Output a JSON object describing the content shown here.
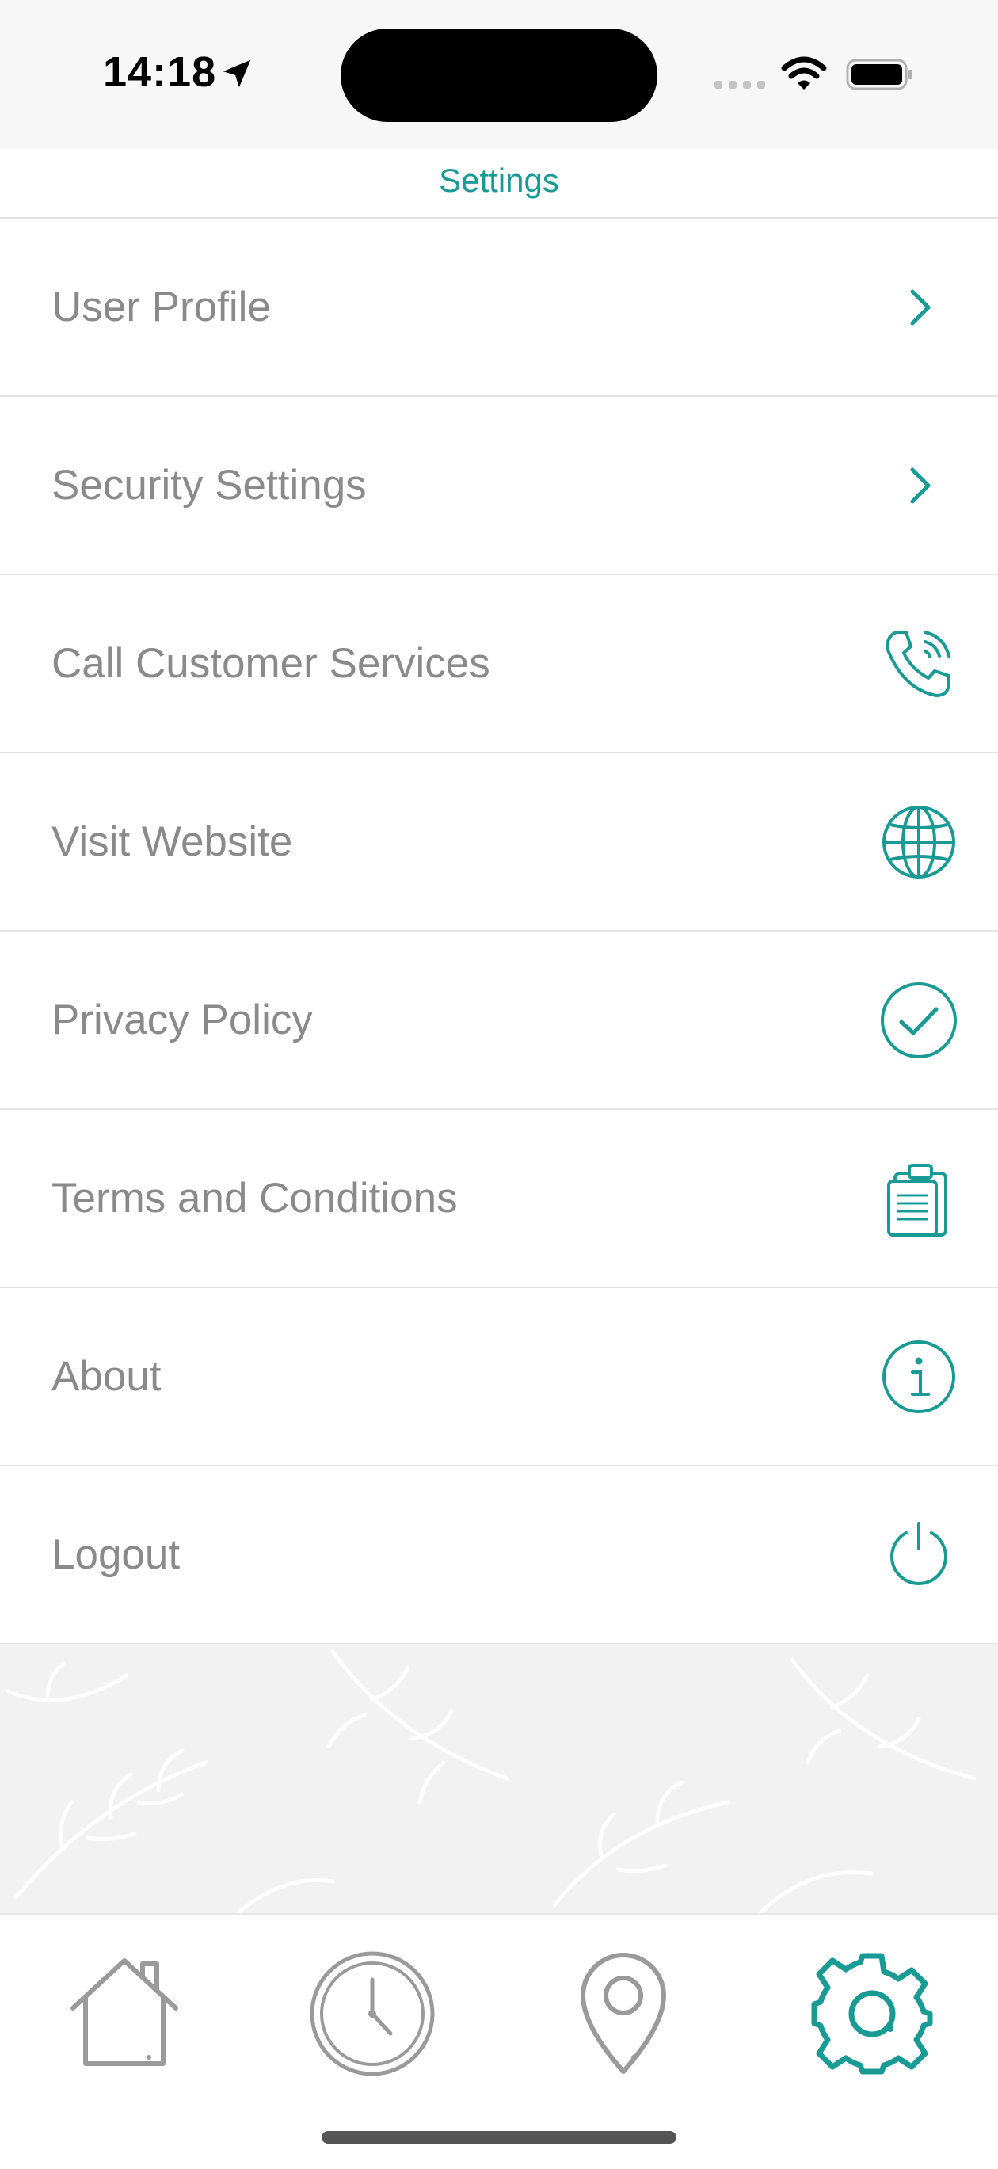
{
  "status_bar": {
    "time": "14:18",
    "icons": [
      "location-arrow-icon",
      "cellular-signal-icon",
      "wifi-icon",
      "battery-icon"
    ]
  },
  "nav": {
    "title": "Settings"
  },
  "colors": {
    "accent": "#1a9a94",
    "label": "#8a8a8a",
    "separator": "#e2e2e2",
    "tab_inactive": "#9a9a9a"
  },
  "settings": {
    "items": [
      {
        "label": "User Profile",
        "icon": "chevron-right-icon"
      },
      {
        "label": "Security Settings",
        "icon": "chevron-right-icon"
      },
      {
        "label": "Call Customer Services",
        "icon": "phone-icon"
      },
      {
        "label": "Visit Website",
        "icon": "globe-icon"
      },
      {
        "label": "Privacy Policy",
        "icon": "check-circle-icon"
      },
      {
        "label": "Terms and Conditions",
        "icon": "clipboard-icon"
      },
      {
        "label": "About",
        "icon": "info-icon"
      },
      {
        "label": "Logout",
        "icon": "power-icon"
      }
    ]
  },
  "tab_bar": {
    "tabs": [
      {
        "icon": "home-icon",
        "selected": false
      },
      {
        "icon": "clock-icon",
        "selected": false
      },
      {
        "icon": "location-pin-icon",
        "selected": false
      },
      {
        "icon": "gear-icon",
        "selected": true
      }
    ]
  }
}
